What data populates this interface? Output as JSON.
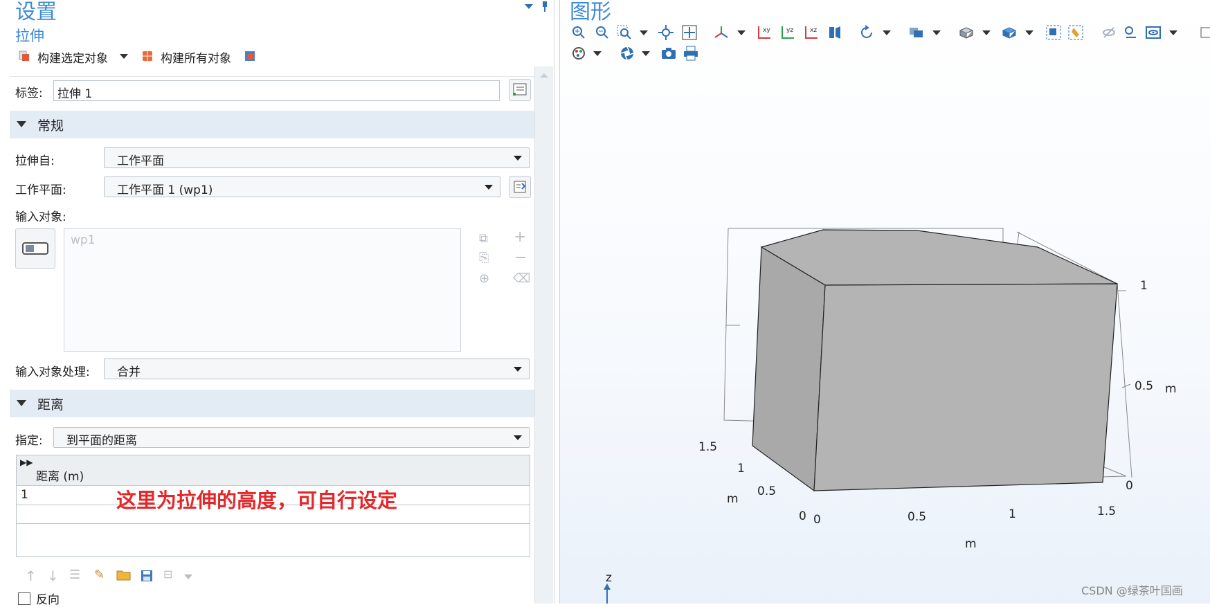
{
  "settings": {
    "header": "设置",
    "feature_title": "拉伸",
    "build_selected": "构建选定对象",
    "build_all": "构建所有对象",
    "label_caption": "标签:",
    "label_value": "拉伸 1",
    "section_general": "常规",
    "extrude_from_caption": "拉伸自:",
    "extrude_from_value": "工作平面",
    "workplane_caption": "工作平面:",
    "workplane_value": "工作平面 1 (wp1)",
    "input_objects_caption": "输入对象:",
    "input_objects_item": "wp1",
    "input_handling_caption": "输入对象处理:",
    "input_handling_value": "合并",
    "section_distance": "距离",
    "specify_caption": "指定:",
    "specify_value": "到平面的距离",
    "table_header": "距离 (m)",
    "table_value": "1",
    "annotation": "这里为拉伸的高度，可自行设定",
    "reverse_label": "反向"
  },
  "graphics": {
    "title": "图形",
    "axis": {
      "x_ticks": [
        "0",
        "0.5",
        "1",
        "1.5"
      ],
      "y_ticks": [
        "0",
        "0.5",
        "1",
        "1.5"
      ],
      "z_ticks": [
        "0",
        "0.5",
        "1"
      ],
      "x_unit": "m",
      "y_unit": "m",
      "z_unit": "m",
      "z_label": "z"
    },
    "watermark": "CSDN @绿茶叶国画"
  },
  "colors": {
    "accent_blue": "#3d8ad6",
    "section_bg": "#e3ebf5",
    "annotation_red": "#e4282a",
    "box_face": "#b4b4b4"
  }
}
